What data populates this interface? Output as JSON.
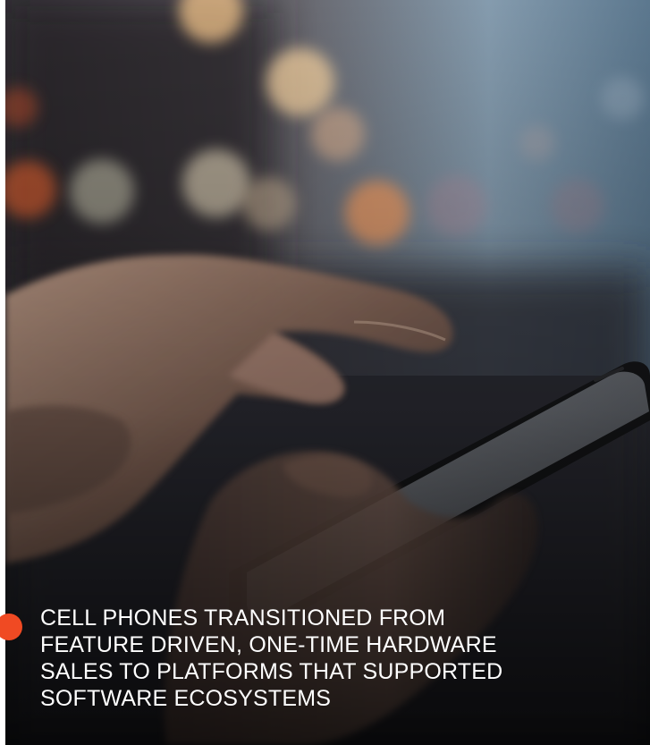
{
  "caption": {
    "lines": [
      "CELL PHONES TRANSITIONED FROM",
      "FEATURE DRIVEN, ONE-TIME HARDWARE",
      "SALES TO PLATFORMS THAT SUPPORTED",
      "SOFTWARE ECOSYSTEMS"
    ]
  },
  "colors": {
    "accent": "#f04a23",
    "caption_text": "#ffffff"
  },
  "photo": {
    "subject": "hand-holding-smartphone-icon"
  }
}
